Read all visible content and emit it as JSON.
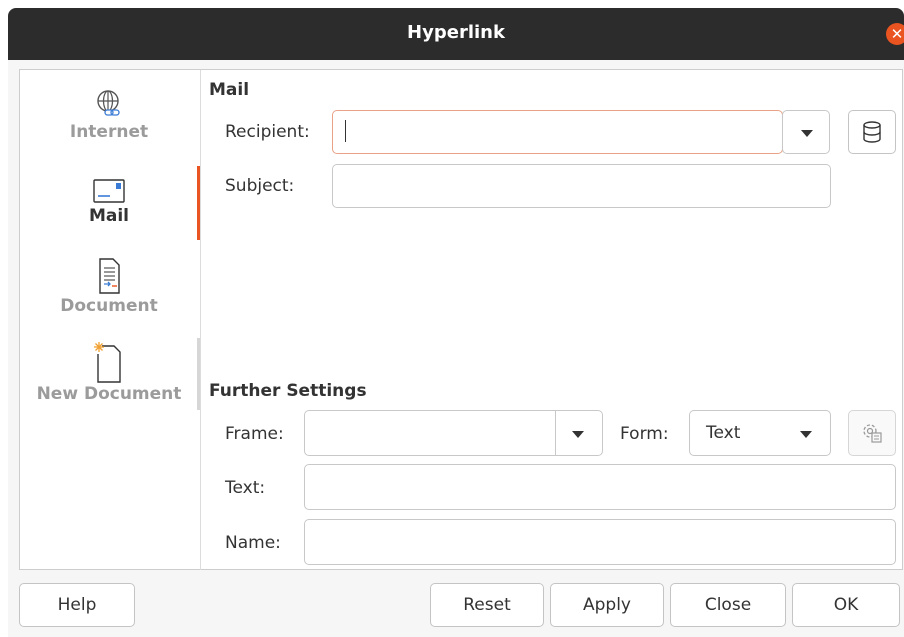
{
  "window": {
    "title": "Hyperlink"
  },
  "sidebar": {
    "items": [
      {
        "label": "Internet",
        "icon": "globe-link-icon",
        "active": false
      },
      {
        "label": "Mail",
        "icon": "envelope-icon",
        "active": true
      },
      {
        "label": "Document",
        "icon": "document-icon",
        "active": false
      },
      {
        "label": "New Document",
        "icon": "new-document-icon",
        "active": false
      }
    ]
  },
  "mail": {
    "section_title": "Mail",
    "recipient_label": "Recipient:",
    "recipient_value": "",
    "subject_label": "Subject:",
    "subject_value": ""
  },
  "further": {
    "section_title": "Further Settings",
    "frame_label": "Frame:",
    "frame_value": "",
    "form_label": "Form:",
    "form_value": "Text",
    "text_label": "Text:",
    "text_value": "",
    "name_label": "Name:",
    "name_value": ""
  },
  "buttons": {
    "help": "Help",
    "reset": "Reset",
    "apply": "Apply",
    "close": "Close",
    "ok": "OK"
  },
  "colors": {
    "accent": "#e95420",
    "titlebar": "#2c2c2c"
  }
}
